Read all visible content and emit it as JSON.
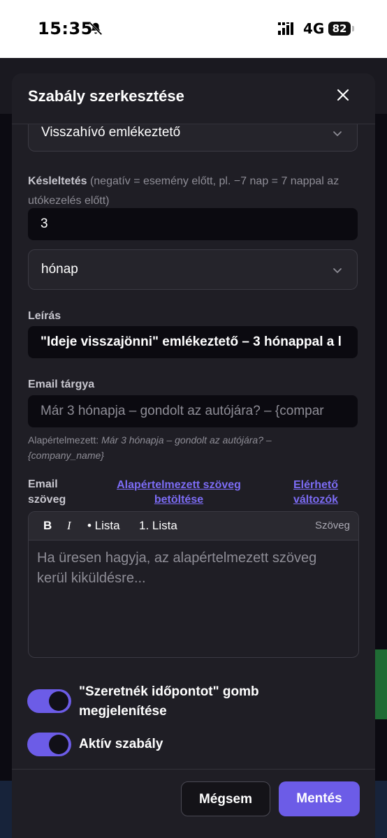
{
  "status_bar": {
    "time": "15:35",
    "network": "4G",
    "battery": "82"
  },
  "modal": {
    "title": "Szabály szerkesztése",
    "rule_type": {
      "value": "Visszahívó emlékeztető"
    },
    "delay": {
      "label": "Késleltetés",
      "hint": "(negatív = esemény előtt, pl. −7 nap = 7 nappal az utókezelés előtt)",
      "value": "3",
      "unit": "hónap"
    },
    "description": {
      "label": "Leírás",
      "value": "\"Ideje visszajönni\" emlékeztető – 3 hónappal a l"
    },
    "email_subject": {
      "label": "Email tárgya",
      "placeholder": "Már 3 hónapja – gondolt az autójára? – {compar",
      "default_prefix": "Alapértelmezett:",
      "default_value": "Már 3 hónapja – gondolt az autójára? – {company_name}"
    },
    "email_body": {
      "label": "Email szöveg",
      "load_default_link": "Alapértelmezett szöveg betöltése",
      "variables_link": "Elérhető változók",
      "toolbar": {
        "bold": "B",
        "italic": "I",
        "bullet_list": "• Lista",
        "numbered_list": "1. Lista",
        "mode": "Szöveg"
      },
      "placeholder": "Ha üresen hagyja, az alapértelmezett szöveg kerül kiküldésre..."
    },
    "toggles": [
      {
        "label": "\"Szeretnék időpontot\" gomb megjelenítése",
        "on": true
      },
      {
        "label": "Aktív szabály",
        "on": true
      }
    ],
    "footer": {
      "cancel": "Mégsem",
      "save": "Mentés"
    }
  },
  "colors": {
    "accent": "#6c5ce7",
    "link": "#7c6cf5",
    "modal_bg": "#1f1e25"
  }
}
